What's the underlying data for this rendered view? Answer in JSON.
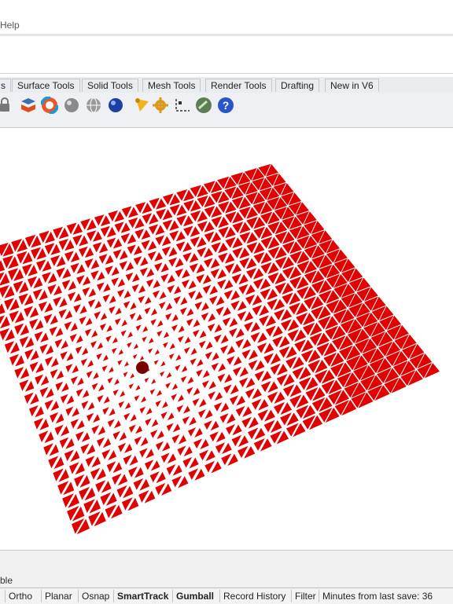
{
  "menu": {
    "help_label": "Help"
  },
  "tabs": [
    {
      "label": "s"
    },
    {
      "label": "Surface Tools"
    },
    {
      "label": "Solid Tools"
    },
    {
      "label": "Mesh Tools"
    },
    {
      "label": "Render Tools"
    },
    {
      "label": "Drafting"
    },
    {
      "label": "New in V6"
    }
  ],
  "toolbar_icons": [
    "lock-icon",
    "layer-material-icon",
    "color-wheel-icon",
    "shaded-sphere-icon",
    "wireframe-sphere-icon",
    "rendered-sphere-icon",
    "light-spot-icon",
    "gear-settings-icon",
    "dimension-icon",
    "grasshopper-icon",
    "help-icon"
  ],
  "command_history": {
    "text": "ble"
  },
  "statusbar": {
    "items": [
      {
        "label": "Ortho",
        "bold": false
      },
      {
        "label": "Planar",
        "bold": false
      },
      {
        "label": "Osnap",
        "bold": false
      },
      {
        "label": "SmartTrack",
        "bold": true
      },
      {
        "label": "Gumball",
        "bold": true
      },
      {
        "label": "Record History",
        "bold": false
      },
      {
        "label": "Filter",
        "bold": false
      },
      {
        "label": "Minutes from last save: 36",
        "bold": false
      }
    ]
  },
  "colors": {
    "triangle_red": "#e00000",
    "attractor_point": "#7a0000",
    "tab_bg": "#e9edf2",
    "toolbar_bg": "#eef0f3"
  }
}
